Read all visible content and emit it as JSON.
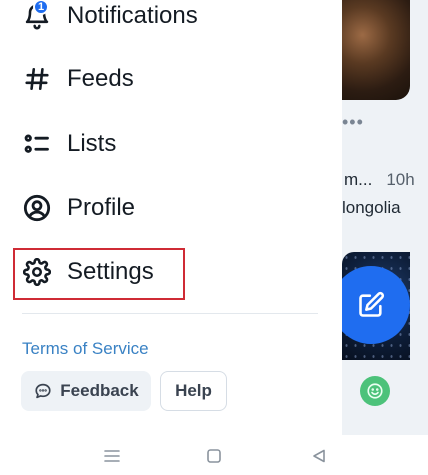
{
  "drawer": {
    "nav_items": [
      {
        "id": "notifications",
        "label": "Notifications",
        "icon": "bell-icon",
        "badge": "1"
      },
      {
        "id": "feeds",
        "label": "Feeds",
        "icon": "hash-icon"
      },
      {
        "id": "lists",
        "label": "Lists",
        "icon": "list-icon"
      },
      {
        "id": "profile",
        "label": "Profile",
        "icon": "user-circle-icon"
      },
      {
        "id": "settings",
        "label": "Settings",
        "icon": "gear-icon",
        "highlighted": true
      }
    ],
    "terms_link": "Terms of Service",
    "feedback_label": "Feedback",
    "help_label": "Help"
  },
  "background_feed": {
    "post_line1": "m... 10h",
    "post_line1_author": "m...",
    "post_line1_time": "10h",
    "post_line2": "longolia",
    "more_dots": "•••"
  },
  "colors": {
    "accent": "#1f6df0",
    "highlight_box": "#cf2b35",
    "link": "#3a82c4",
    "badge": "#1f6df0",
    "smile_badge": "#4cc27a"
  }
}
